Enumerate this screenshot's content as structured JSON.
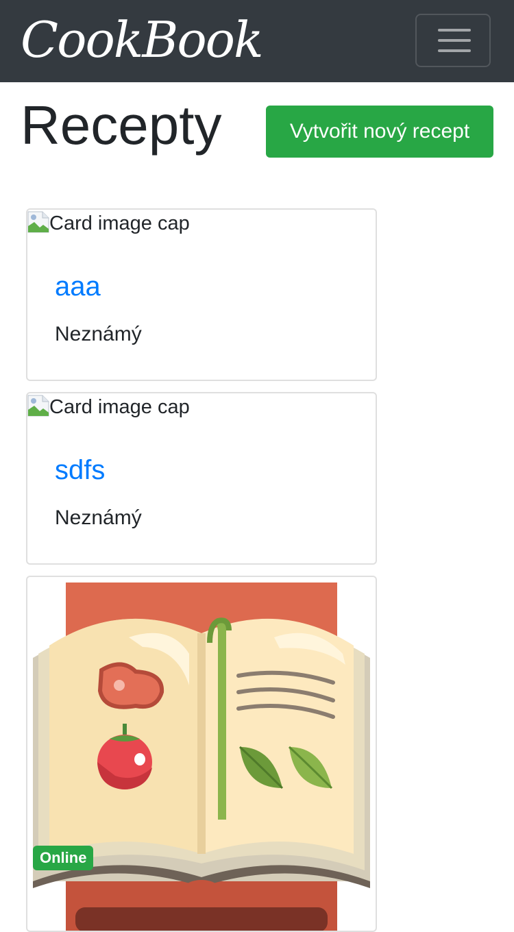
{
  "navbar": {
    "brand": "CookBook",
    "toggler_icon": "hamburger-menu-icon"
  },
  "header": {
    "title": "Recepty",
    "create_button_label": "Vytvořit nový recept"
  },
  "recipes": [
    {
      "image_alt": "Card image cap",
      "title": "aaa",
      "subtitle": "Neznámý"
    },
    {
      "image_alt": "Card image cap",
      "title": "sdfs",
      "subtitle": "Neznámý"
    },
    {
      "image_icon": "cookbook-illustration",
      "badge": "Online"
    }
  ],
  "colors": {
    "navbar_bg": "#343a40",
    "success": "#28a745",
    "link": "#007bff"
  }
}
